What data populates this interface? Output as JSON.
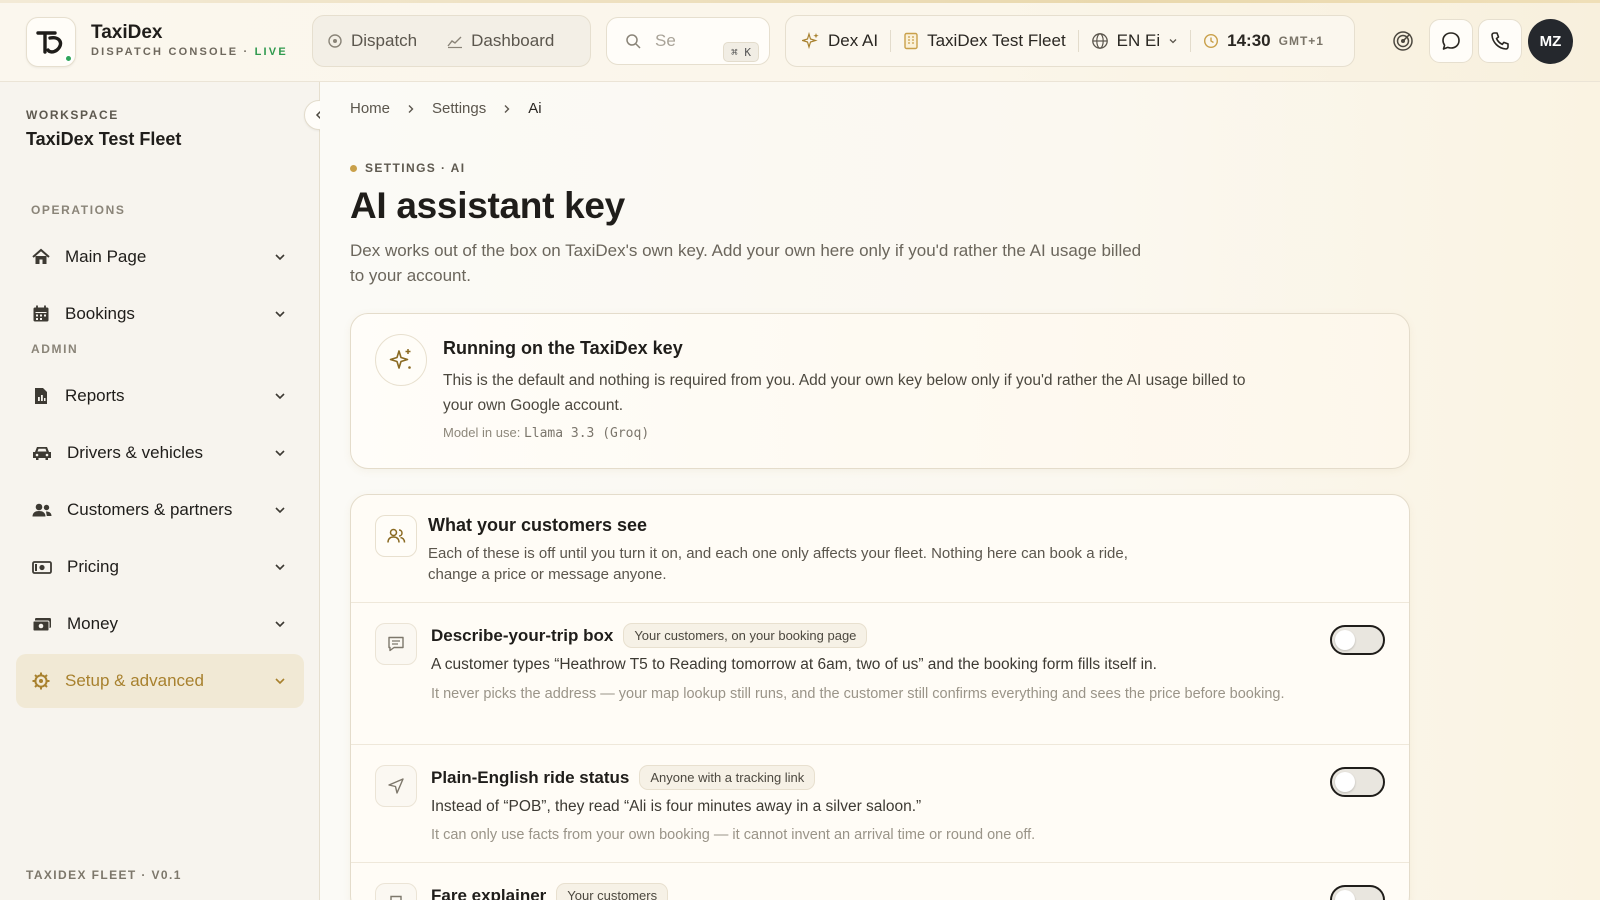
{
  "app": {
    "name": "TaxiDex",
    "subtitle_prefix": "DISPATCH CONSOLE · ",
    "live": "LIVE"
  },
  "topnav": {
    "dispatch": "Dispatch",
    "dashboard": "Dashboard",
    "search_placeholder": "Search",
    "search_placeholder_visible": "Se",
    "search_shortcut": "⌘ K",
    "dex_ai": "Dex AI",
    "fleet": "TaxiDex Test Fleet",
    "language": "EN Ei",
    "time": "14:30",
    "timezone": "GMT+1",
    "avatar": "MZ"
  },
  "sidebar": {
    "workspace_label": "WORKSPACE",
    "workspace_name": "TaxiDex Test Fleet",
    "operations_label": "OPERATIONS",
    "admin_label": "ADMIN",
    "items": [
      {
        "label": "Main Page",
        "icon": "home-icon"
      },
      {
        "label": "Bookings",
        "icon": "calendar-icon"
      },
      {
        "label": "Reports",
        "icon": "report-icon"
      },
      {
        "label": "Drivers & vehicles",
        "icon": "car-icon"
      },
      {
        "label": "Customers & partners",
        "icon": "users-icon"
      },
      {
        "label": "Pricing",
        "icon": "money-bill-icon"
      },
      {
        "label": "Money",
        "icon": "cash-icon"
      },
      {
        "label": "Setup & advanced",
        "icon": "gear-icon",
        "active": true
      }
    ],
    "footer": "TAXIDEX FLEET · V0.1"
  },
  "breadcrumb": [
    "Home",
    "Settings",
    "Ai"
  ],
  "page": {
    "eyebrow": "SETTINGS · AI",
    "title": "AI assistant key",
    "description": "Dex works out of the box on TaxiDex's own key. Add your own here only if you'd rather the AI usage billed to your account."
  },
  "key_card": {
    "title": "Running on the TaxiDex key",
    "description": "This is the default and nothing is required from you. Add your own key below only if you'd rather the AI usage billed to your own Google account.",
    "model_label": "Model in use: ",
    "model_value": "Llama 3.3 (Groq)"
  },
  "customers_card": {
    "title": "What your customers see",
    "description": "Each of these is off until you turn it on, and each one only affects your fleet. Nothing here can book a ride, change a price or message anyone.",
    "features": [
      {
        "title": "Describe-your-trip box",
        "audience": "Your customers, on your booking page",
        "line1": "A customer types “Heathrow T5 to Reading tomorrow at 6am, two of us” and the booking form fills itself in.",
        "line2": "It never picks the address — your map lookup still runs, and the customer still confirms everything and sees the price before booking.",
        "enabled": false
      },
      {
        "title": "Plain-English ride status",
        "audience": "Anyone with a tracking link",
        "line1": "Instead of “POB”, they read “Ali is four minutes away in a silver saloon.”",
        "line2": "It can only use facts from your own booking — it cannot invent an arrival time or round one off.",
        "enabled": false
      },
      {
        "title": "Fare explainer",
        "audience": "Your customers",
        "line1": "",
        "line2": "",
        "enabled": false
      }
    ]
  },
  "colors": {
    "accent": "#c9a04a",
    "live": "#2f9a4e",
    "active_nav_bg": "#f1e9d5",
    "active_nav_text": "#a8812e"
  }
}
